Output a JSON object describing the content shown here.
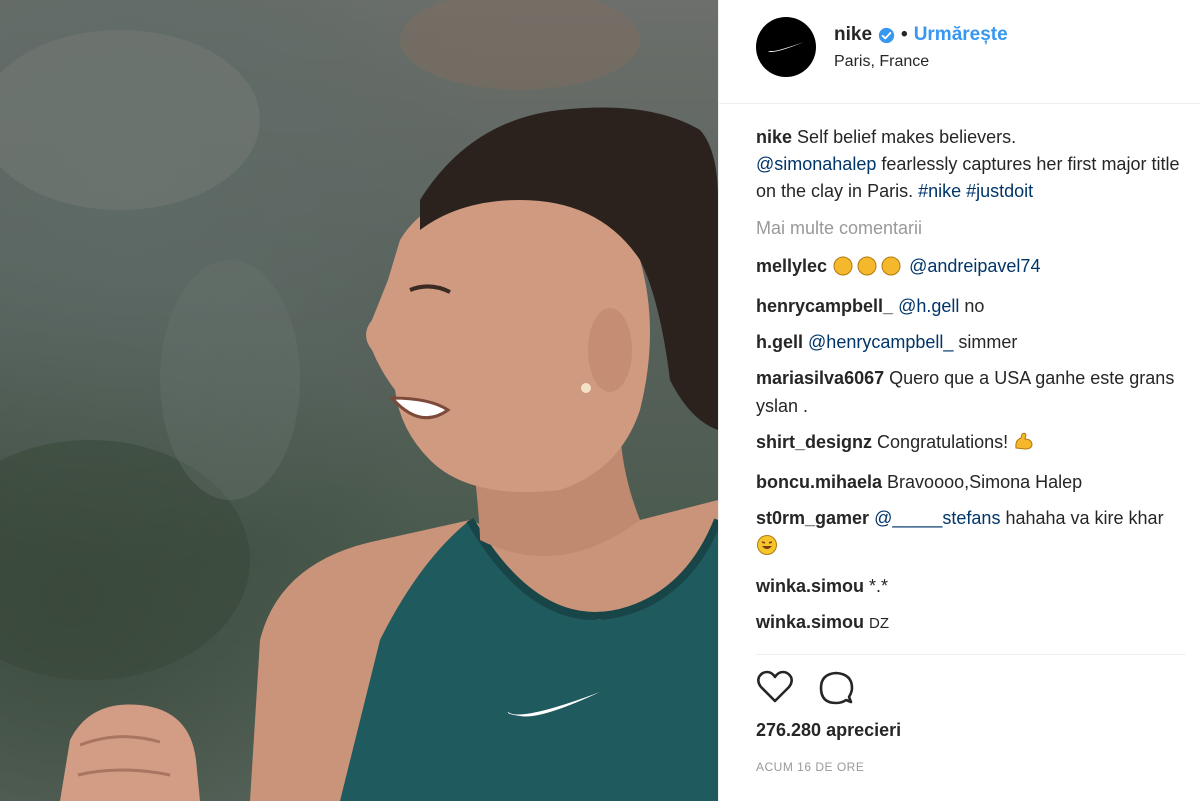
{
  "post": {
    "username": "nike",
    "follow_label": "Urmărește",
    "location": "Paris, France",
    "caption": {
      "user": "nike",
      "line1": "Self belief makes believers.",
      "mention": "@simonahalep",
      "line2": "fearlessly captures her first major title on the clay in Paris.",
      "hashtag1": "#nike",
      "hashtag2": "#justdoit"
    },
    "more_comments_label": "Mai multe comentarii",
    "comments": [
      {
        "user": "mellylec",
        "mention": "@andreipavel74"
      },
      {
        "user": "henrycampbell_",
        "mention": "@h.gell",
        "text": "no"
      },
      {
        "user": "h.gell",
        "mention": "@henrycampbell_",
        "text": "simmer"
      },
      {
        "user": "mariasilva6067",
        "text": "Quero que a USA ganhe este grans yslan ."
      },
      {
        "user": "shirt_designz",
        "text": "Congratulations!"
      },
      {
        "user": "boncu.mihaela",
        "text": "Bravoooo,Simona Halep"
      },
      {
        "user": "st0rm_gamer",
        "mention": "@_____stefans",
        "text": "hahaha va kire khar"
      },
      {
        "user": "winka.simou",
        "text": "*.*"
      },
      {
        "user": "winka.simou",
        "text": "DZ"
      }
    ],
    "likes_label": "276.280 aprecieri",
    "timestamp": "ACUM 16 DE ORE"
  },
  "icons": {
    "avatar": "nike-swoosh-icon",
    "verified": "verified-badge-icon",
    "like": "heart-icon",
    "comment": "comment-icon"
  },
  "colors": {
    "link": "#3897f0",
    "hashtag": "#003569",
    "muted": "#999999",
    "text": "#262626"
  }
}
